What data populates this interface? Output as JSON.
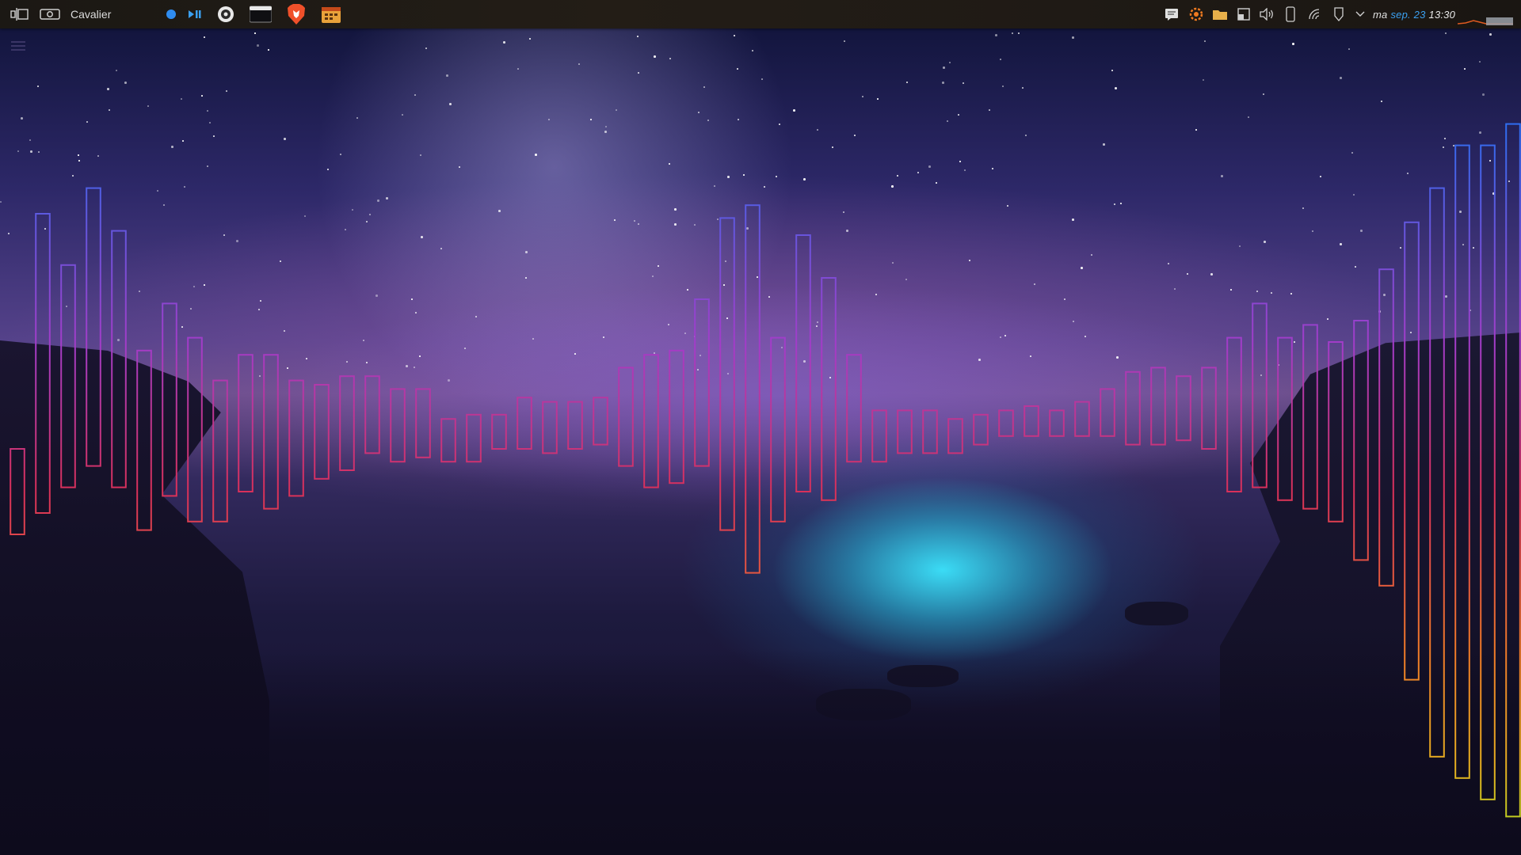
{
  "panel": {
    "app_title": "Cavalier",
    "clock": {
      "day": "ma",
      "date": "sep. 23",
      "time": "13:30"
    },
    "launchers": [
      "activities-icon",
      "screenshot-icon",
      "record-dot-icon",
      "play-pause-icon",
      "obs-icon",
      "terminal-icon",
      "brave-icon",
      "calendar-app-icon"
    ],
    "tray": [
      "notes-icon",
      "settings-gear-icon",
      "folder-icon",
      "window-icon",
      "volume-icon",
      "phone-icon",
      "network-icon",
      "usb-icon",
      "chevron-down-icon"
    ],
    "colors": {
      "accent": "#3ba0f0",
      "panel_bg": "#1f1a15",
      "brave_orange": "#f0502a"
    }
  },
  "visualizer": {
    "app": "Cavalier",
    "style": "outlined-bars",
    "colors": {
      "top": "#2f6df0",
      "mid": "#d9305a",
      "low": "#f07a28",
      "bottom": "#a6e020"
    },
    "bars": [
      [
        -0.05,
        0.25
      ],
      [
        0.5,
        0.2
      ],
      [
        0.38,
        0.14
      ],
      [
        0.56,
        0.09
      ],
      [
        0.46,
        0.14
      ],
      [
        0.18,
        0.24
      ],
      [
        0.29,
        0.16
      ],
      [
        0.21,
        0.22
      ],
      [
        0.11,
        0.22
      ],
      [
        0.17,
        0.15
      ],
      [
        0.17,
        0.19
      ],
      [
        0.11,
        0.16
      ],
      [
        0.1,
        0.12
      ],
      [
        0.12,
        0.1
      ],
      [
        0.12,
        0.06
      ],
      [
        0.09,
        0.08
      ],
      [
        0.09,
        0.07
      ],
      [
        0.02,
        0.08
      ],
      [
        0.03,
        0.08
      ],
      [
        0.03,
        0.05
      ],
      [
        0.07,
        0.05
      ],
      [
        0.06,
        0.06
      ],
      [
        0.06,
        0.05
      ],
      [
        0.07,
        0.04
      ],
      [
        0.14,
        0.09
      ],
      [
        0.17,
        0.14
      ],
      [
        0.18,
        0.13
      ],
      [
        0.3,
        0.09
      ],
      [
        0.49,
        0.24
      ],
      [
        0.52,
        0.34
      ],
      [
        0.21,
        0.22
      ],
      [
        0.45,
        0.15
      ],
      [
        0.35,
        0.17
      ],
      [
        0.17,
        0.08
      ],
      [
        0.04,
        0.08
      ],
      [
        0.04,
        0.06
      ],
      [
        0.04,
        0.06
      ],
      [
        0.02,
        0.06
      ],
      [
        0.03,
        0.04
      ],
      [
        0.04,
        0.02
      ],
      [
        0.05,
        0.02
      ],
      [
        0.04,
        0.02
      ],
      [
        0.06,
        0.02
      ],
      [
        0.09,
        0.02
      ],
      [
        0.13,
        0.04
      ],
      [
        0.14,
        0.04
      ],
      [
        0.12,
        0.03
      ],
      [
        0.14,
        0.05
      ],
      [
        0.21,
        0.15
      ],
      [
        0.29,
        0.14
      ],
      [
        0.21,
        0.17
      ],
      [
        0.24,
        0.19
      ],
      [
        0.2,
        0.22
      ],
      [
        0.25,
        0.31
      ],
      [
        0.37,
        0.37
      ],
      [
        0.48,
        0.59
      ],
      [
        0.56,
        0.77
      ],
      [
        0.66,
        0.82
      ],
      [
        0.66,
        0.87
      ],
      [
        0.71,
        0.91
      ]
    ]
  },
  "wallpaper": {
    "description_colors": {
      "sky_top": "#0e1236",
      "horizon": "#6a4f8c",
      "glow": "#3ce6ff",
      "ground": "#120f28"
    }
  }
}
